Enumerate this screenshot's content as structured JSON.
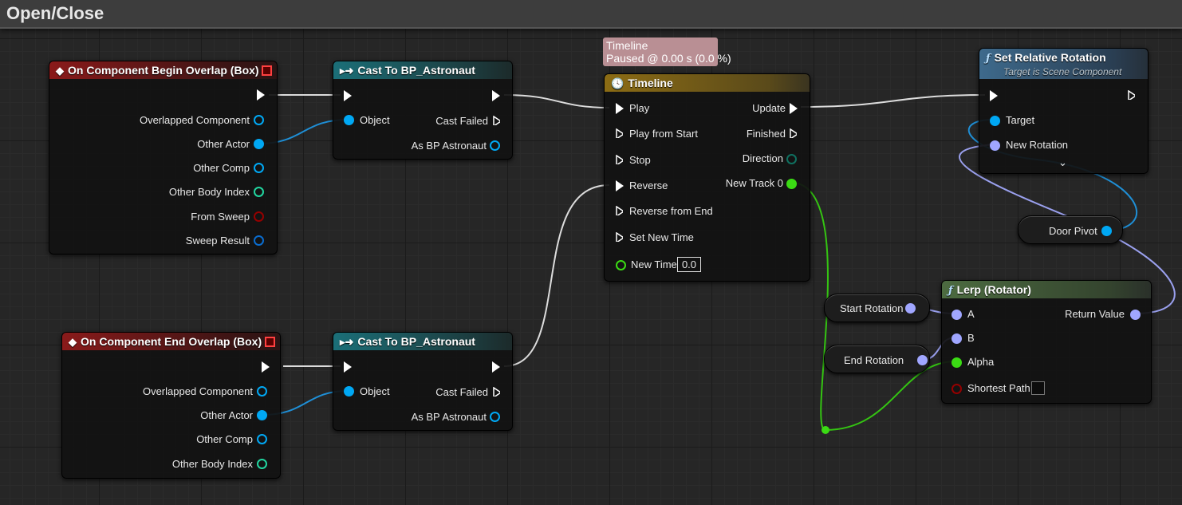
{
  "graph": {
    "title": "Open/Close"
  },
  "tooltip": {
    "line1": "Timeline",
    "line2": "Paused @ 0.00 s (0.0 %)"
  },
  "begin_overlap": {
    "title": "On Component Begin Overlap (Box)",
    "pins": [
      "Overlapped Component",
      "Other Actor",
      "Other Comp",
      "Other Body Index",
      "From Sweep",
      "Sweep Result"
    ]
  },
  "end_overlap": {
    "title": "On Component End Overlap (Box)",
    "pins": [
      "Overlapped Component",
      "Other Actor",
      "Other Comp",
      "Other Body Index"
    ]
  },
  "cast1": {
    "title": "Cast To BP_Astronaut",
    "object": "Object",
    "cast_failed": "Cast Failed",
    "as_bp": "As BP Astronaut"
  },
  "cast2": {
    "title": "Cast To BP_Astronaut",
    "object": "Object",
    "cast_failed": "Cast Failed",
    "as_bp": "As BP Astronaut"
  },
  "timeline": {
    "title": "Timeline",
    "inputs": [
      "Play",
      "Play from Start",
      "Stop",
      "Reverse",
      "Reverse from End",
      "Set New Time"
    ],
    "new_time_label": "New Time",
    "new_time_value": "0.0",
    "outputs": [
      "Update",
      "Finished",
      "Direction",
      "New Track 0"
    ]
  },
  "set_rotation": {
    "title": "Set Relative Rotation",
    "subtitle": "Target is Scene Component",
    "target": "Target",
    "new_rotation": "New Rotation"
  },
  "lerp": {
    "title": "Lerp (Rotator)",
    "a": "A",
    "b": "B",
    "alpha": "Alpha",
    "shortest_path": "Shortest Path",
    "return_value": "Return Value"
  },
  "vars": {
    "door_pivot": "Door Pivot",
    "start_rotation": "Start Rotation",
    "end_rotation": "End Rotation"
  },
  "colors": {
    "object_pin": "#00a8f4",
    "rotator_pin": "#a0a6ff",
    "float_pin": "#3bdb14",
    "int_pin": "#22d6a0",
    "struct_pin": "#0a6ccf",
    "bool_pin": "#950000",
    "event_header": "#8a1a1a",
    "cast_header": "#1b6f78",
    "timeline_header": "#8c6c14",
    "function_header": "#3e6a8c",
    "pure_header": "#4c6b40"
  }
}
